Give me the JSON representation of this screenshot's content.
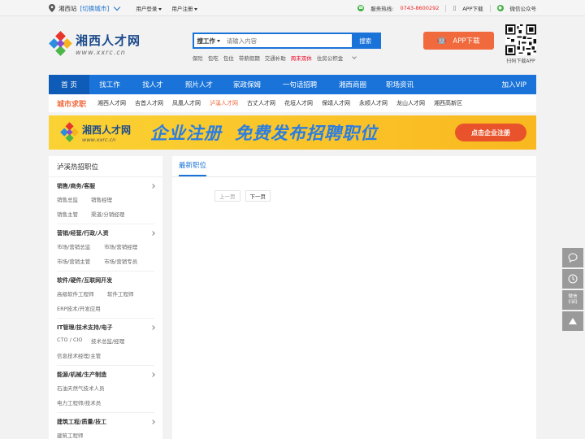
{
  "topbar": {
    "site": "湘西站",
    "switch_city": "[切换城市]",
    "user_login": "用户登录",
    "user_register": "用户注册",
    "hotline_label": "服务热线:",
    "hotline_number": "0743-8600292",
    "app_download": "APP下载",
    "wechat": "微信公众号"
  },
  "logo": {
    "cn": "湘西人才网",
    "en": "www.xxrc.cn"
  },
  "search": {
    "type": "搜工作",
    "placeholder": "请输入内容",
    "button": "搜索",
    "hot_words": [
      "保险",
      "包吃",
      "包住",
      "带薪假期",
      "交通补助",
      "周末双休",
      "住房公积金"
    ],
    "highlight_index": 5
  },
  "app_button": "APP下载",
  "qr_caption": "扫码下载APP",
  "nav": {
    "items": [
      "首 页",
      "找工作",
      "找人才",
      "照片人才",
      "家政保姆",
      "一句话招聘",
      "湘西商圈",
      "职场资讯"
    ],
    "right": "加入VIP"
  },
  "citybar": {
    "title": "城市求职",
    "cities": [
      "湘西人才网",
      "吉首人才网",
      "凤凰人才网",
      "泸溪人才网",
      "古丈人才网",
      "花垣人才网",
      "保靖人才网",
      "永顺人才网",
      "龙山人才网",
      "湘西高新区"
    ],
    "current_index": 3
  },
  "banner": {
    "logo_cn": "湘西人才网",
    "logo_en": "www.xxrc.cn",
    "text1": "企业注册",
    "text2": "免费发布招聘职位",
    "button": "点击企业注册"
  },
  "sidebar": {
    "title": "泸溪热招职位",
    "categories": [
      {
        "name": "销售/商务/客服",
        "items": [
          "销售总监",
          "销售经理",
          "销售主管",
          "渠道/分销经理"
        ]
      },
      {
        "name": "营销/经营/行政/人资",
        "items": [
          "市场/营销总监",
          "市场/营销经理",
          "市场/营销主管",
          "市场/营销专员"
        ]
      },
      {
        "name": "软件/硬件/互联网开发",
        "items": [
          "高级软件工程师",
          "软件工程师",
          "ERP技术/开发应用"
        ]
      },
      {
        "name": "IT管理/技术支持/电子",
        "items": [
          "CTO / CIO",
          "技术总监/经理",
          "信息技术经理/主管"
        ]
      },
      {
        "name": "能源/机械/生产制造",
        "items": [
          "石油天然气技术人员",
          "电力工程师/技术员"
        ]
      },
      {
        "name": "建筑工程/质量/技工",
        "items": [
          "建筑工程师"
        ]
      }
    ]
  },
  "content": {
    "title": "最新职位",
    "prev": "上一页",
    "next": "下一页"
  },
  "float": {
    "consult": "",
    "history": "",
    "qr_label": "微信\n扫码"
  },
  "colors": {
    "primary": "#1a73d9",
    "accent": "#f06a3e",
    "banner": "#fbd233"
  }
}
